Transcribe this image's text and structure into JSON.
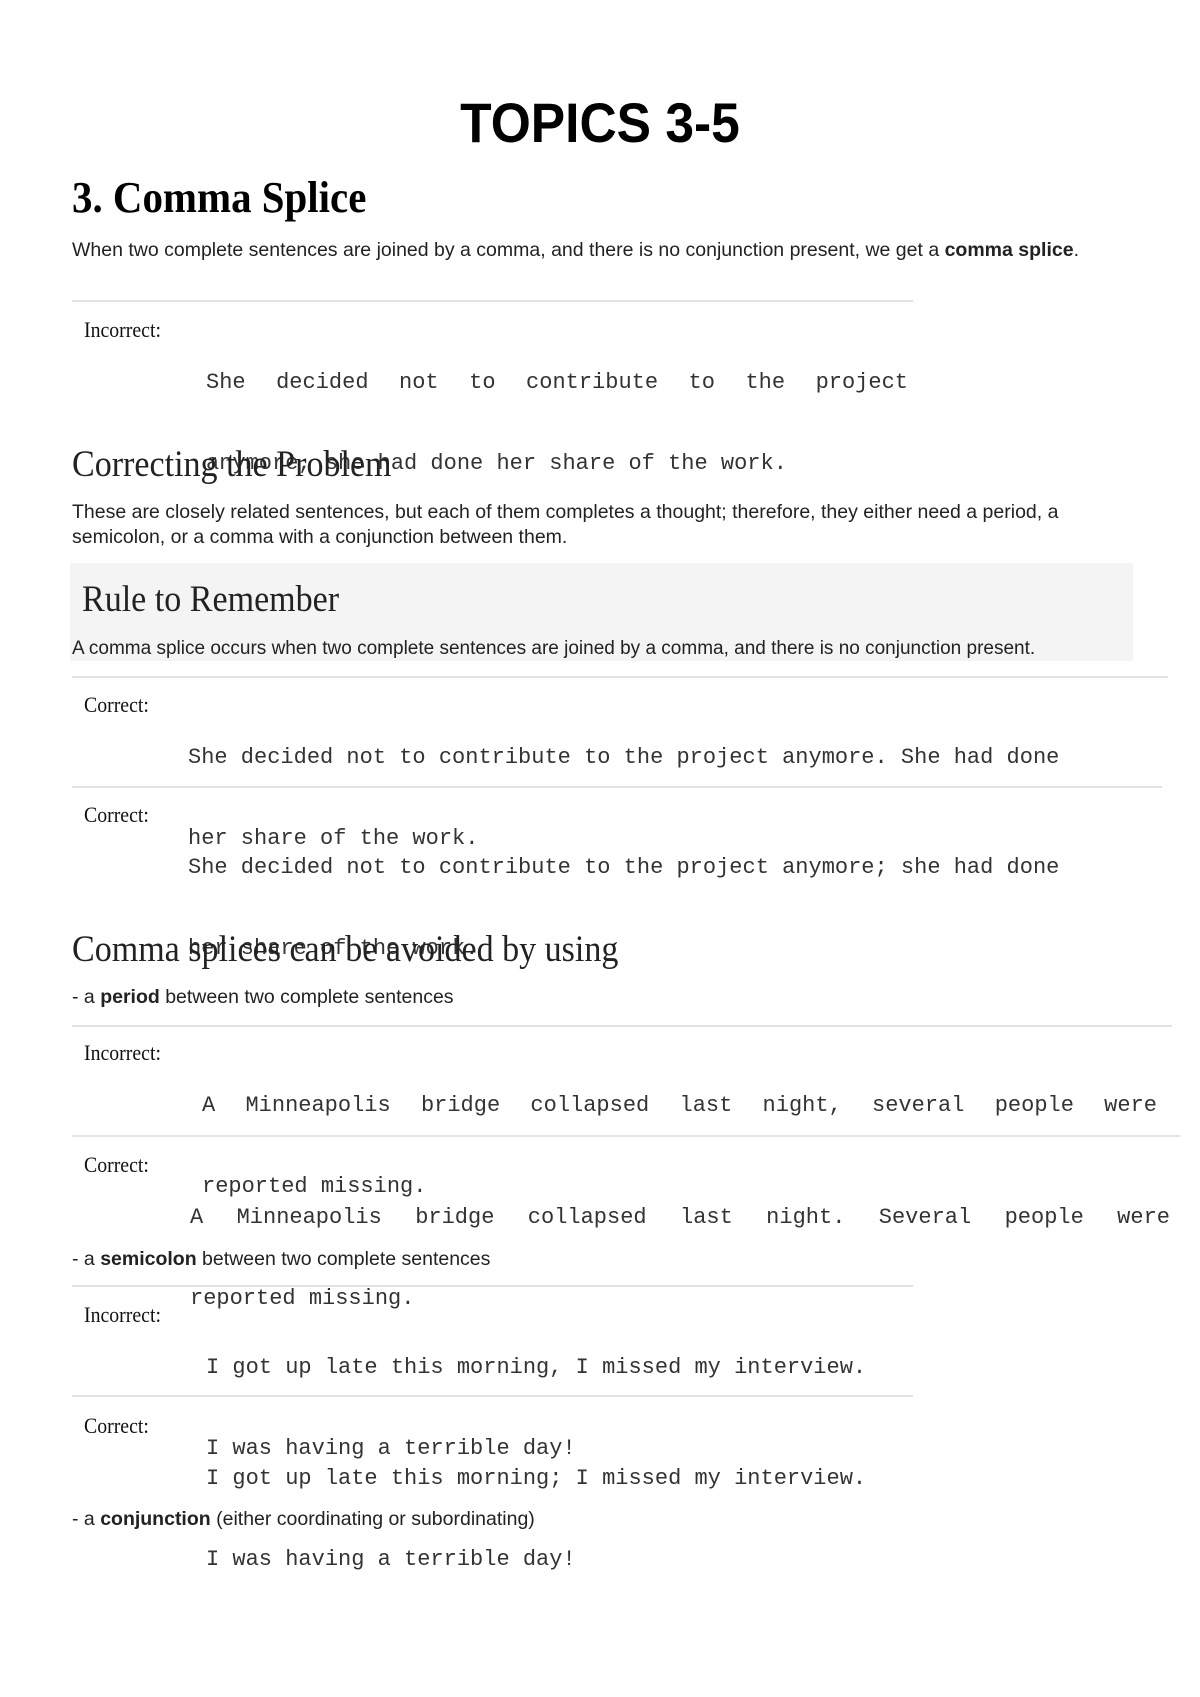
{
  "document": {
    "title": "TOPICS 3-5",
    "section_heading": "3. Comma Splice",
    "intro": {
      "text_before": "When two complete sentences are joined by a comma, and there is no conjunction present, we get a ",
      "bold": "comma splice",
      "text_after": "."
    },
    "example_1": {
      "label": "Incorrect:",
      "line1": "She decided not to contribute to the project",
      "line2": "anymore, she had done her share of the work."
    },
    "correcting": {
      "heading": "Correcting the Problem",
      "paragraph": "These are closely related sentences, but each of them completes a thought; therefore, they either need a period, a semicolon, or a comma with a conjunction between them."
    },
    "rule": {
      "heading": "Rule to Remember",
      "text": "A comma splice occurs when two complete sentences are joined by a comma, and there is no conjunction present."
    },
    "correct_examples": [
      {
        "label": "Correct:",
        "line1": "She decided not to contribute to the project anymore. She had done",
        "line2": "her share of the work."
      },
      {
        "label": "Correct:",
        "line1": "She decided not to contribute to the project anymore; she had done",
        "line2": "her share of the work."
      }
    ],
    "avoid": {
      "heading": "Comma splices can be avoided by using",
      "methods": [
        {
          "prefix": "- a ",
          "bold": "period",
          "suffix": " between two complete sentences",
          "examples": [
            {
              "label": "Incorrect:",
              "line1": "A Minneapolis bridge collapsed last night, several people were",
              "line2": "reported missing."
            },
            {
              "label": "Correct:",
              "line1": "A Minneapolis bridge collapsed last night. Several people were",
              "line2": "reported missing."
            }
          ]
        },
        {
          "prefix": "- a ",
          "bold": "semicolon",
          "suffix": " between two complete sentences",
          "examples": [
            {
              "label": "Incorrect:",
              "line1": "I got up late this morning, I missed my interview.",
              "line2": "I was having a terrible day!"
            },
            {
              "label": "Correct:",
              "line1": "I got up late this morning; I missed my interview.",
              "line2": "I was having a terrible day!"
            }
          ]
        },
        {
          "prefix": "- a ",
          "bold": "conjunction",
          "suffix": " (either coordinating or subordinating)"
        }
      ]
    }
  }
}
